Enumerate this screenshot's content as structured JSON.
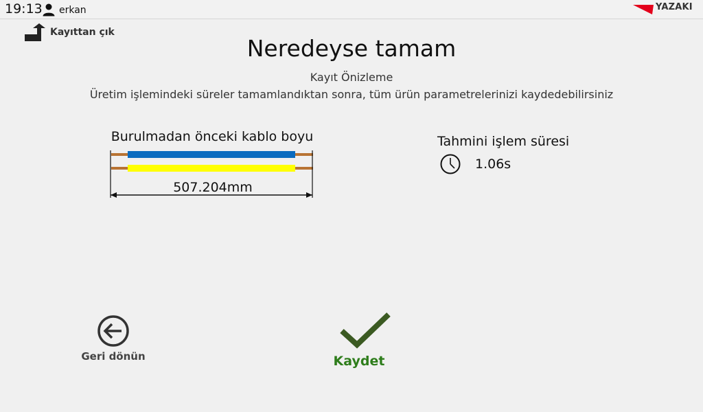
{
  "status_bar": {
    "time": "19:13",
    "username": "erkan",
    "brand": "YAZAKI"
  },
  "header": {
    "logout_label": "Kayıttan çık",
    "title": "Neredeyse tamam",
    "subtitle": "Kayıt Önizleme",
    "description": "Üretim işlemindeki süreler tamamlandıktan sonra, tüm ürün parametrelerinizi kaydedebilirsiniz"
  },
  "cable": {
    "label": "Burulmadan önceki kablo boyu",
    "length": "507.204mm",
    "colors": {
      "wire_top": "#0a6bbf",
      "wire_bottom": "#ffff00",
      "wire_ends": "#b87333"
    }
  },
  "process": {
    "label": "Tahmini işlem süresi",
    "duration": "1.06s",
    "icon": "clock-icon"
  },
  "actions": {
    "back_label": "Geri dönün",
    "save_label": "Kaydet",
    "save_color": "#2e7d1b",
    "save_icon_color": "#3b5a22"
  }
}
